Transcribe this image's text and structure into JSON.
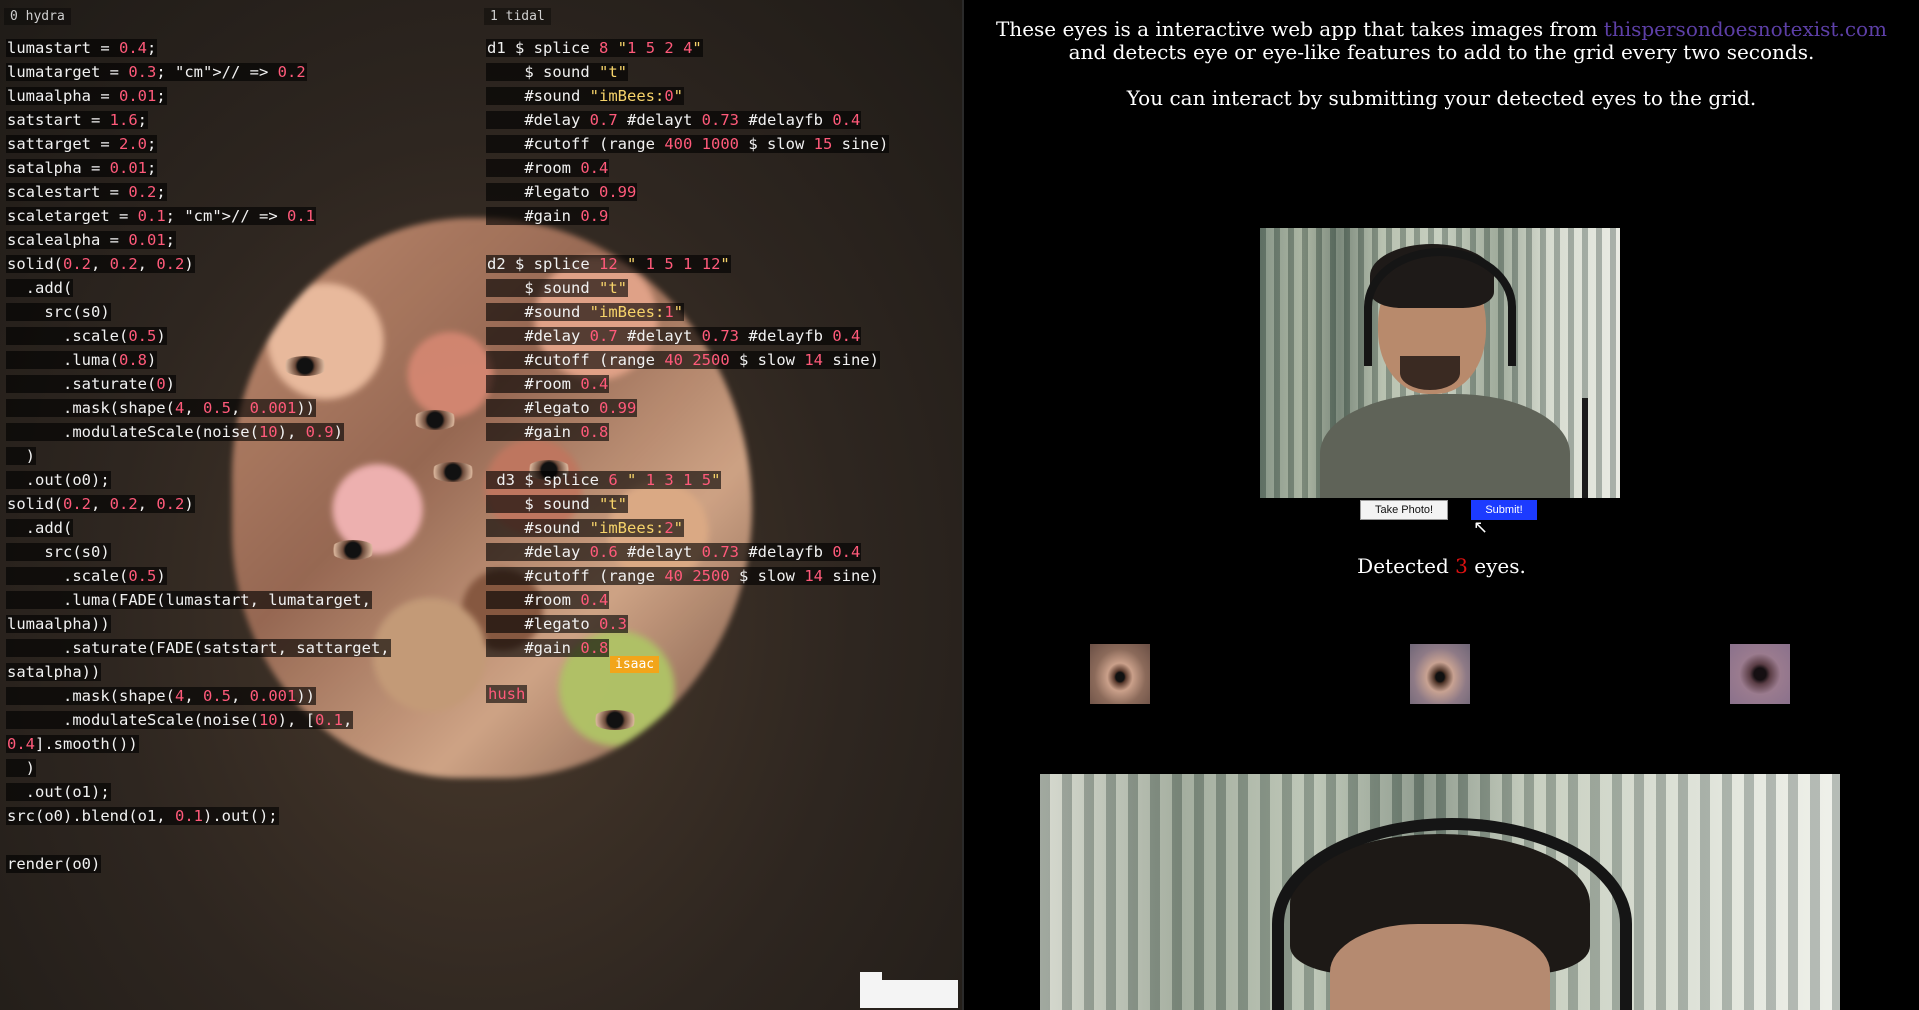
{
  "left": {
    "pane_hydra": "0 hydra",
    "pane_tidal": "1 tidal",
    "hydra_lines": [
      "lumastart = 0.4;",
      "lumatarget = 0.3; // => 0.2",
      "lumaalpha = 0.01;",
      "satstart = 1.6;",
      "sattarget = 2.0;",
      "satalpha = 0.01;",
      "scalestart = 0.2;",
      "scaletarget = 0.1; // => 0.1",
      "scalealpha = 0.01;",
      "solid(0.2, 0.2, 0.2)",
      "  .add(",
      "    src(s0)",
      "      .scale(0.5)",
      "      .luma(0.8)",
      "      .saturate(0)",
      "      .mask(shape(4, 0.5, 0.001))",
      "      .modulateScale(noise(10), 0.9)",
      "  )",
      "  .out(o0);",
      "solid(0.2, 0.2, 0.2)",
      "  .add(",
      "    src(s0)",
      "      .scale(0.5)",
      "      .luma(FADE(lumastart, lumatarget,",
      "lumaalpha))",
      "      .saturate(FADE(satstart, sattarget,",
      "satalpha))",
      "      .mask(shape(4, 0.5, 0.001))",
      "      .modulateScale(noise(10), [0.1,",
      "0.4].smooth())",
      "  )",
      "  .out(o1);",
      "src(o0).blend(o1, 0.1).out();",
      "",
      "render(o0)"
    ],
    "tidal_lines": [
      "d1 $ splice 8 \"1 5 2 4\"",
      "    $ sound \"t\"",
      "    #sound \"imBees:0\"",
      "    #delay 0.7 #delayt 0.73 #delayfb 0.4",
      "    #cutoff (range 400 1000 $ slow 15 sine)",
      "    #room 0.4",
      "    #legato 0.99",
      "    #gain 0.9",
      "",
      "d2 $ splice 12 \" 1 5 1 12\"",
      "    $ sound \"t\"",
      "    #sound \"imBees:1\"",
      "    #delay 0.7 #delayt 0.73 #delayfb 0.4",
      "    #cutoff (range 40 2500 $ slow 14 sine)",
      "    #room 0.4",
      "    #legato 0.99",
      "    #gain 0.8",
      "",
      " d3 $ splice 6 \" 1 3 1 5\"",
      "    $ sound \"t\"",
      "    #sound \"imBees:2\"",
      "    #delay 0.6 #delayt 0.73 #delayfb 0.4",
      "    #cutoff (range 40 2500 $ slow 14 sine)",
      "    #room 0.4",
      "    #legato 0.3",
      "    #gain 0.8"
    ],
    "tag": "isaac",
    "hush": "hush"
  },
  "right": {
    "intro_before": "These eyes is a interactive web app that takes images from ",
    "intro_link": "thispersondoesnotexist.com",
    "intro_after": " and detects eye or eye-like features to add to the grid every two seconds.",
    "intro2": "You can interact by submitting your detected eyes to the grid.",
    "take_photo": "Take Photo!",
    "submit": "Submit!",
    "detected_before": "Detected ",
    "detected_count": "3",
    "detected_after": " eyes."
  },
  "colors": {
    "code_highlight": "#ff5a7a",
    "submit_button": "#1c3bff",
    "link": "#5d3fa7",
    "count": "#dd1111",
    "tag": "#f2a51a"
  }
}
